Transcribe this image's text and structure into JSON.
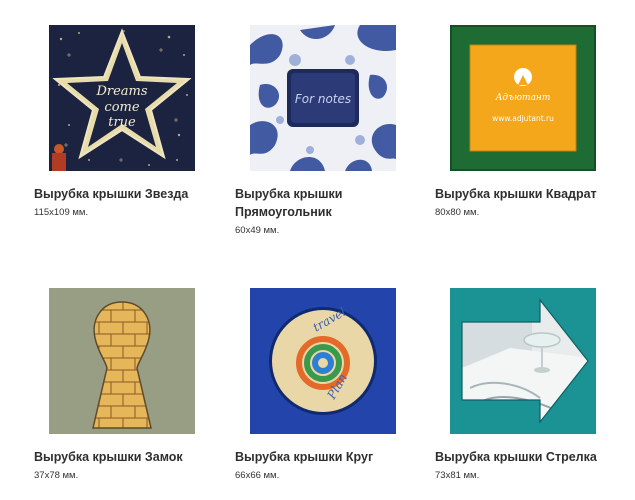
{
  "products": [
    {
      "title": "Вырубка крышки Звезда",
      "size": "115x109 мм.",
      "image_text": [
        "Dreams",
        "come",
        "true"
      ]
    },
    {
      "title": "Вырубка крышки Прямоугольник",
      "size": "60x49 мм.",
      "image_text": [
        "For notes"
      ]
    },
    {
      "title": "Вырубка крышки Квадрат",
      "size": "80x80 мм.",
      "image_text": [
        "Адъютант",
        "www.adjutant.ru"
      ]
    },
    {
      "title": "Вырубка крышки Замок",
      "size": "37x78 мм."
    },
    {
      "title": "Вырубка крышки Круг",
      "size": "66x66 мм.",
      "image_text": [
        "travel",
        "Plan"
      ]
    },
    {
      "title": "Вырубка крышки Стрелка",
      "size": "73x81 мм."
    }
  ]
}
